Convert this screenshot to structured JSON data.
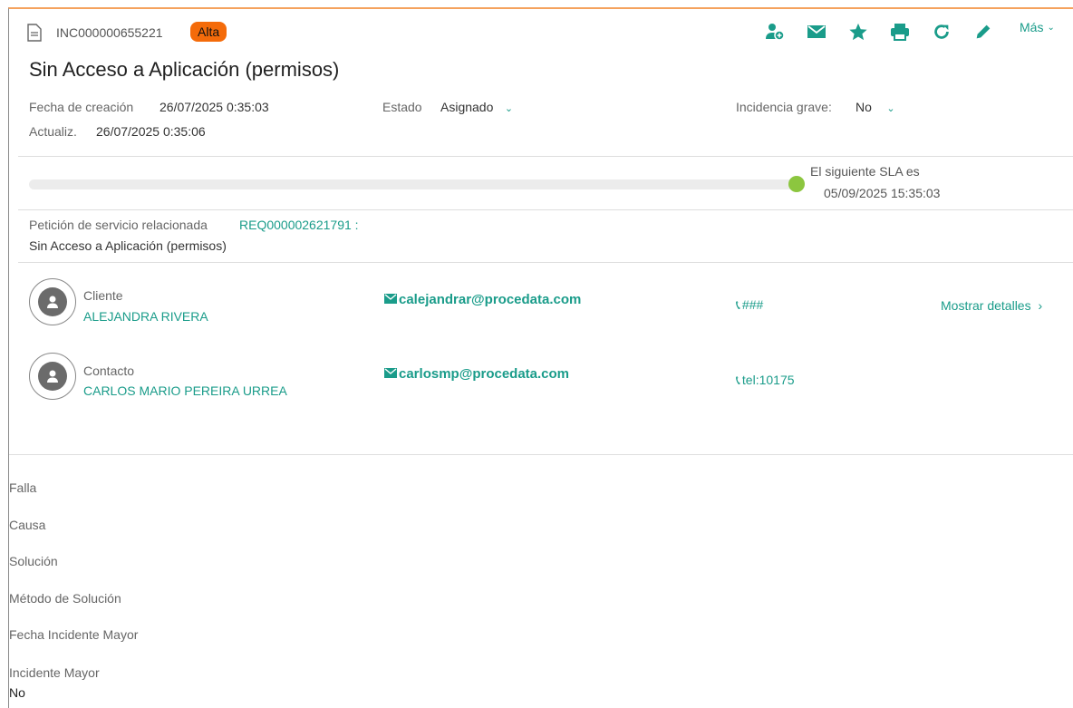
{
  "header": {
    "incident_id": "INC000000655221",
    "priority_badge": "Alta",
    "title": "Sin Acceso a Aplicación (permisos)",
    "more_label": "Más"
  },
  "toolbar_icons": [
    "add-person-icon",
    "email-icon",
    "star-icon",
    "print-icon",
    "refresh-icon",
    "edit-icon"
  ],
  "meta": {
    "created_label": "Fecha de creación",
    "created_value": "26/07/2025 0:35:03",
    "updated_label": "Actualiz.",
    "updated_value": "26/07/2025 0:35:06",
    "status_label": "Estado",
    "status_value": "Asignado",
    "major_label": "Incidencia grave:",
    "major_value": "No"
  },
  "sla": {
    "label": "El siguiente SLA es",
    "date": "05/09/2025 15:35:03",
    "progress_percent": 100
  },
  "related": {
    "label": "Petición de servicio relacionada",
    "link": "REQ000002621791 :",
    "description": "Sin Acceso a Aplicación (permisos)"
  },
  "people": {
    "customer": {
      "role": "Cliente",
      "name": "ALEJANDRA RIVERA",
      "email": "calejandrar@procedata.com",
      "phone": "###",
      "details_link": "Mostrar detalles"
    },
    "contact": {
      "role": "Contacto",
      "name": "CARLOS MARIO PEREIRA URREA",
      "email": "carlosmp@procedata.com",
      "phone": "tel:10175"
    }
  },
  "fields": {
    "falla": "Falla",
    "causa": "Causa",
    "solucion": "Solución",
    "metodo": "Método de Solución",
    "fecha_mayor": "Fecha Incidente Mayor",
    "incidente_mayor_label": "Incidente Mayor",
    "incidente_mayor_value": "No"
  },
  "colors": {
    "accent": "#1a9c8a",
    "badge": "#f46b0a",
    "sla_dot": "#8cc63f"
  }
}
